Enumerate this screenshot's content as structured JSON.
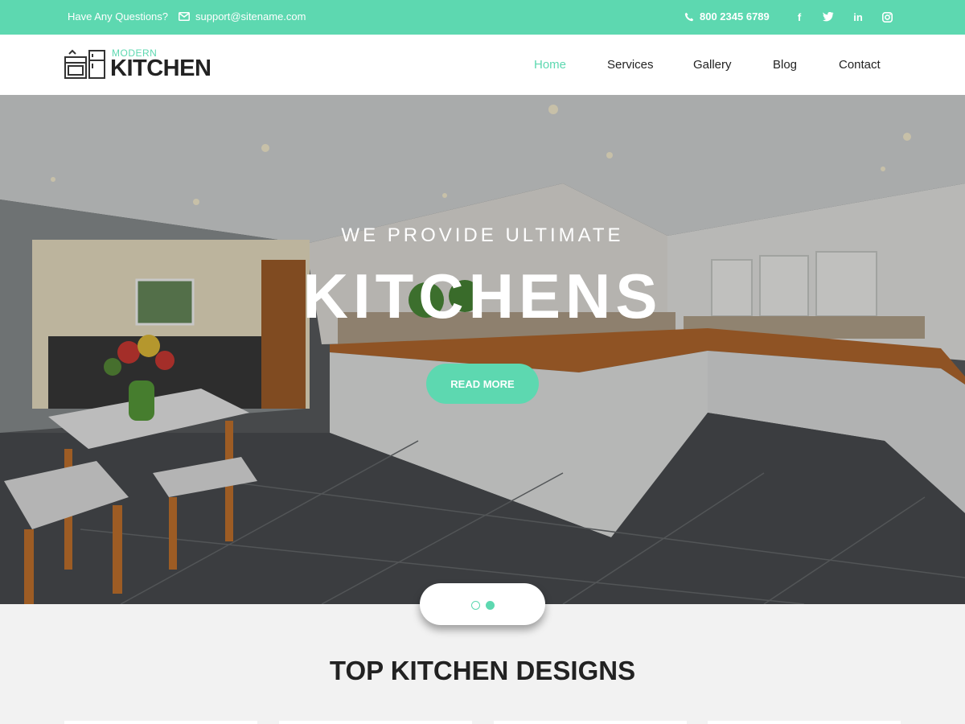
{
  "topbar": {
    "question": "Have Any Questions?",
    "email": "support@sitename.com",
    "phone": "800 2345 6789",
    "social": [
      "facebook-icon",
      "twitter-icon",
      "linkedin-icon",
      "instagram-icon"
    ],
    "social_glyphs": [
      "f",
      "🐦",
      "in",
      "◎"
    ]
  },
  "logo": {
    "small": "MODERN",
    "big": "KITCHEN"
  },
  "nav": [
    {
      "label": "Home",
      "active": true
    },
    {
      "label": "Services"
    },
    {
      "label": "Gallery"
    },
    {
      "label": "Blog"
    },
    {
      "label": "Contact"
    }
  ],
  "hero": {
    "subtitle": "WE PROVIDE ULTIMATE",
    "title": "KITCHENS",
    "button": "READ MORE"
  },
  "slider": {
    "dots": 2,
    "active": 2
  },
  "section": {
    "title": "TOP KITCHEN DESIGNS"
  },
  "colors": {
    "accent": "#5dd8b0",
    "text": "#222222"
  }
}
